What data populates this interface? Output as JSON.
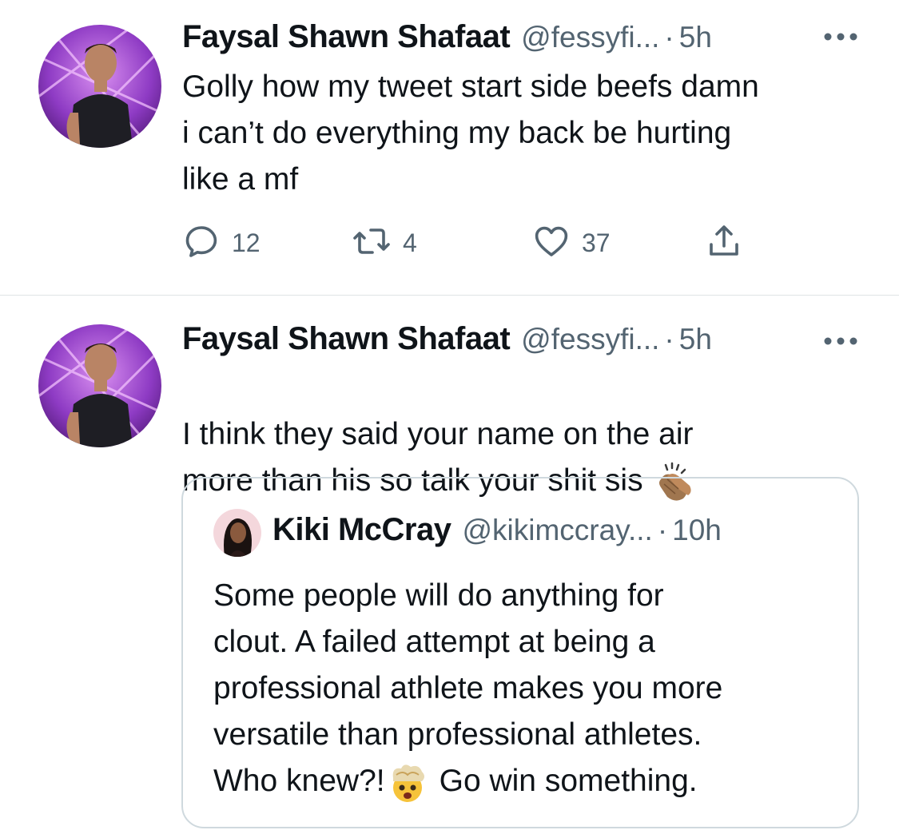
{
  "tweets": [
    {
      "author": "Faysal Shawn Shafaat",
      "handle": "@fessyfi...",
      "separator": "·",
      "time": "5h",
      "text": "Golly how my tweet start side beefs damn\ni can’t do everything my back be hurting\nlike a mf",
      "replies": "12",
      "retweets": "4",
      "likes": "37"
    },
    {
      "author": "Faysal Shawn Shafaat",
      "handle": "@fessyfi...",
      "separator": "·",
      "time": "5h",
      "text_line1": "I think they said your name on the air",
      "text_line2": "more than his so talk your shit sis",
      "emoji": "clapping-hands-medium-skin",
      "quote": {
        "author": "Kiki McCray",
        "handle": "@kikimccray...",
        "separator": "·",
        "time": "10h",
        "lines": [
          "Some people will do anything for",
          "clout. A failed attempt at being a",
          "professional athlete makes you more",
          "versatile than professional athletes."
        ],
        "last_line_a": "Who knew?!",
        "last_line_b": "Go win something.",
        "emoji": "exploding-head"
      }
    }
  ],
  "colors": {
    "text": "#0f1419",
    "secondary": "#536471",
    "border": "#cfd9de",
    "divider": "#dfe3e6"
  }
}
